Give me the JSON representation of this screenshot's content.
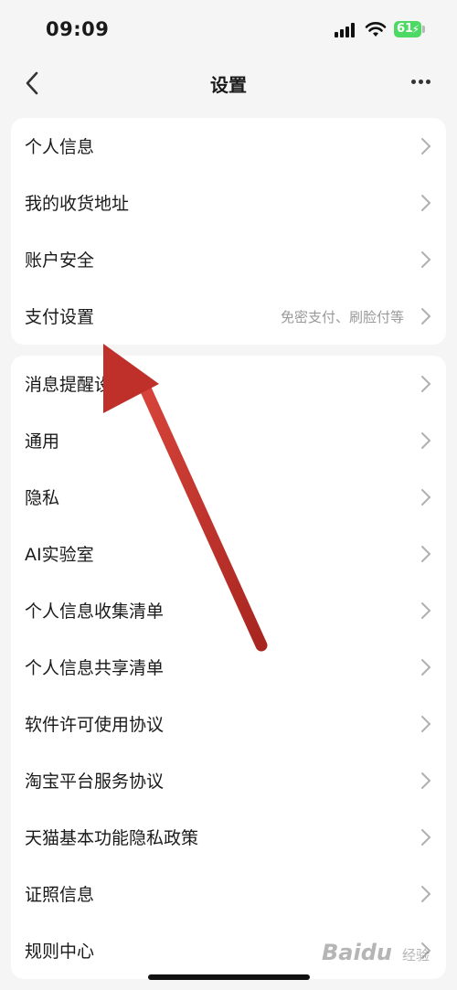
{
  "status_bar": {
    "time": "09:09",
    "battery": "61"
  },
  "nav": {
    "title": "设置",
    "back_icon": "chevron-left-icon",
    "more_icon": "more-dots-icon"
  },
  "groups": [
    {
      "items": [
        {
          "label": "个人信息"
        },
        {
          "label": "我的收货地址"
        },
        {
          "label": "账户安全"
        },
        {
          "label": "支付设置",
          "sub": "免密支付、刷脸付等"
        }
      ]
    },
    {
      "items": [
        {
          "label": "消息提醒设置"
        },
        {
          "label": "通用"
        },
        {
          "label": "隐私"
        },
        {
          "label": "AI实验室"
        },
        {
          "label": "个人信息收集清单"
        },
        {
          "label": "个人信息共享清单"
        },
        {
          "label": "软件许可使用协议"
        },
        {
          "label": "淘宝平台服务协议"
        },
        {
          "label": "天猫基本功能隐私政策"
        },
        {
          "label": "证照信息"
        },
        {
          "label": "规则中心"
        }
      ]
    }
  ],
  "annotation": {
    "arrow_color": "#c0302a"
  },
  "watermark": {
    "text": "Baidu",
    "sub": "经验"
  }
}
